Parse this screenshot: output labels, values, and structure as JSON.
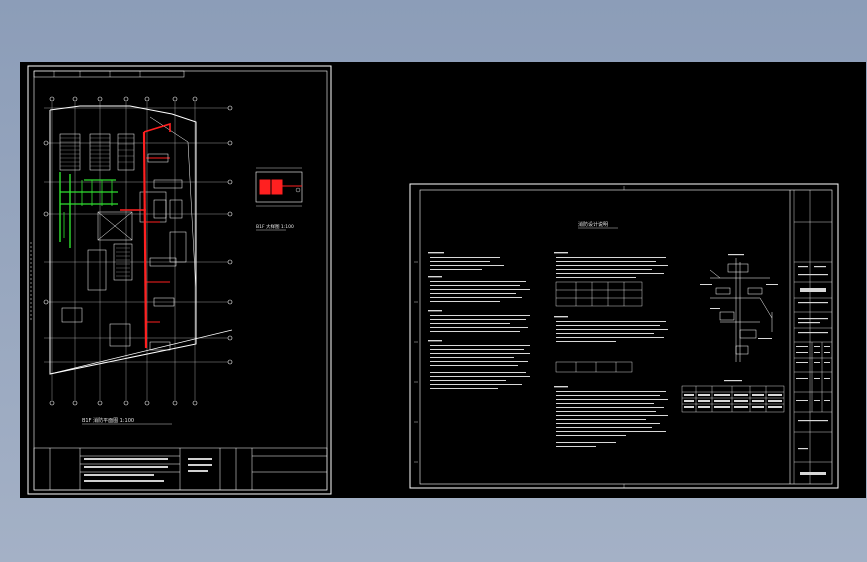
{
  "drawing": {
    "sheet1": {
      "main_plan_label": "B1F 消防平面图 1:100",
      "detail_plan_label": "B1F 大样图 1:100",
      "detail_scale": "1:100"
    },
    "sheet2": {
      "title": "消防设计说明"
    }
  },
  "colors": {
    "canvas": "#000000",
    "linework": "#ffffff",
    "fire_pipe": "#ff2020",
    "sprinkler": "#30e030",
    "background": "#9aa8bf"
  }
}
